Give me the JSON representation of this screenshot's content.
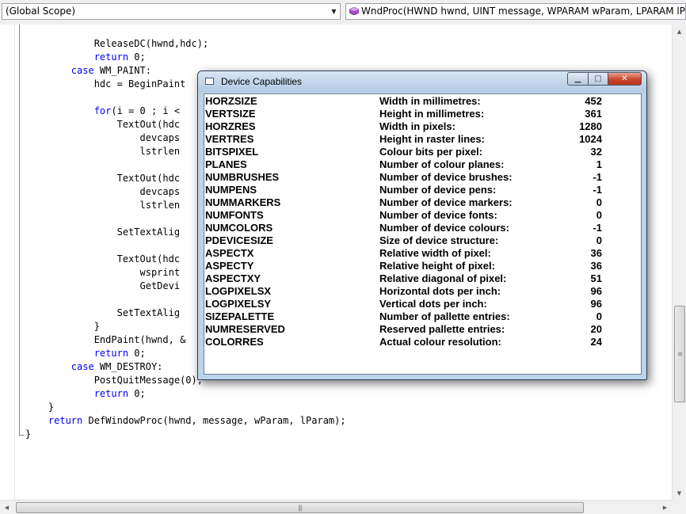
{
  "toolbar": {
    "scope": "(Global Scope)",
    "procedure": "WndProc(HWND hwnd, UINT message, WPARAM wParam, LPARAM lPara"
  },
  "code_lines": [
    {
      "indent": "            ",
      "kw": "",
      "text": "ReleaseDC(hwnd,hdc);"
    },
    {
      "indent": "            ",
      "kw": "return",
      "text": " 0;"
    },
    {
      "indent": "        ",
      "kw": "case",
      "text": " WM_PAINT:"
    },
    {
      "indent": "            ",
      "kw": "",
      "text": "hdc = BeginPaint"
    },
    {
      "indent": "",
      "kw": "",
      "text": ""
    },
    {
      "indent": "            ",
      "kw": "for",
      "text": "(i = 0 ; i <"
    },
    {
      "indent": "                ",
      "kw": "",
      "text": "TextOut(hdc"
    },
    {
      "indent": "                    ",
      "kw": "",
      "text": "devcaps"
    },
    {
      "indent": "                    ",
      "kw": "",
      "text": "lstrlen"
    },
    {
      "indent": "",
      "kw": "",
      "text": ""
    },
    {
      "indent": "                ",
      "kw": "",
      "text": "TextOut(hdc"
    },
    {
      "indent": "                    ",
      "kw": "",
      "text": "devcaps"
    },
    {
      "indent": "                    ",
      "kw": "",
      "text": "lstrlen"
    },
    {
      "indent": "",
      "kw": "",
      "text": ""
    },
    {
      "indent": "                ",
      "kw": "",
      "text": "SetTextAlig"
    },
    {
      "indent": "",
      "kw": "",
      "text": ""
    },
    {
      "indent": "                ",
      "kw": "",
      "text": "TextOut(hdc"
    },
    {
      "indent": "                    ",
      "kw": "",
      "text": "wsprint"
    },
    {
      "indent": "                    ",
      "kw": "",
      "text": "GetDevi"
    },
    {
      "indent": "",
      "kw": "",
      "text": ""
    },
    {
      "indent": "                ",
      "kw": "",
      "text": "SetTextAlig"
    },
    {
      "indent": "            ",
      "kw": "",
      "text": "}"
    },
    {
      "indent": "            ",
      "kw": "",
      "text": "EndPaint(hwnd, &"
    },
    {
      "indent": "            ",
      "kw": "return",
      "text": " 0;"
    },
    {
      "indent": "        ",
      "kw": "case",
      "text": " WM_DESTROY:"
    },
    {
      "indent": "            ",
      "kw": "",
      "text": "PostQuitMessage(0);"
    },
    {
      "indent": "            ",
      "kw": "return",
      "text": " 0;"
    },
    {
      "indent": "    ",
      "kw": "",
      "text": "}"
    },
    {
      "indent": "    ",
      "kw": "return",
      "text": " DefWindowProc(hwnd, message, wParam, lParam);"
    },
    {
      "indent": "",
      "kw": "",
      "text": "}"
    }
  ],
  "dialog": {
    "title": "Device Capabilities",
    "rows": [
      {
        "name": "HORZSIZE",
        "desc": "Width in millimetres:",
        "value": "452"
      },
      {
        "name": "VERTSIZE",
        "desc": "Height in millimetres:",
        "value": "361"
      },
      {
        "name": "HORZRES",
        "desc": "Width in pixels:",
        "value": "1280"
      },
      {
        "name": "VERTRES",
        "desc": "Height in raster lines:",
        "value": "1024"
      },
      {
        "name": "BITSPIXEL",
        "desc": "Colour bits per pixel:",
        "value": "32"
      },
      {
        "name": "PLANES",
        "desc": "Number of colour planes:",
        "value": "1"
      },
      {
        "name": "NUMBRUSHES",
        "desc": "Number of device brushes:",
        "value": "-1"
      },
      {
        "name": "NUMPENS",
        "desc": "Number of device pens:",
        "value": "-1"
      },
      {
        "name": "NUMMARKERS",
        "desc": "Number of device markers:",
        "value": "0"
      },
      {
        "name": "NUMFONTS",
        "desc": "Number of device fonts:",
        "value": "0"
      },
      {
        "name": "NUMCOLORS",
        "desc": "Number of device colours:",
        "value": "-1"
      },
      {
        "name": "PDEVICESIZE",
        "desc": "Size of device structure:",
        "value": "0"
      },
      {
        "name": "ASPECTX",
        "desc": "Relative width of pixel:",
        "value": "36"
      },
      {
        "name": "ASPECTY",
        "desc": "Relative height of pixel:",
        "value": "36"
      },
      {
        "name": "ASPECTXY",
        "desc": "Relative diagonal of pixel:",
        "value": "51"
      },
      {
        "name": "LOGPIXELSX",
        "desc": "Horizontal dots per inch:",
        "value": "96"
      },
      {
        "name": "LOGPIXELSY",
        "desc": "Vertical dots per inch:",
        "value": "96"
      },
      {
        "name": "SIZEPALETTE",
        "desc": "Number of pallette entries:",
        "value": "0"
      },
      {
        "name": "NUMRESERVED",
        "desc": "Reserved pallette entries:",
        "value": "20"
      },
      {
        "name": "COLORRES",
        "desc": "Actual colour resolution:",
        "value": "24"
      }
    ]
  },
  "colors": {
    "keyword": "#0000ff",
    "text": "#000000",
    "close_button": "#c9442a",
    "titlebar": "#c3d6ea"
  }
}
